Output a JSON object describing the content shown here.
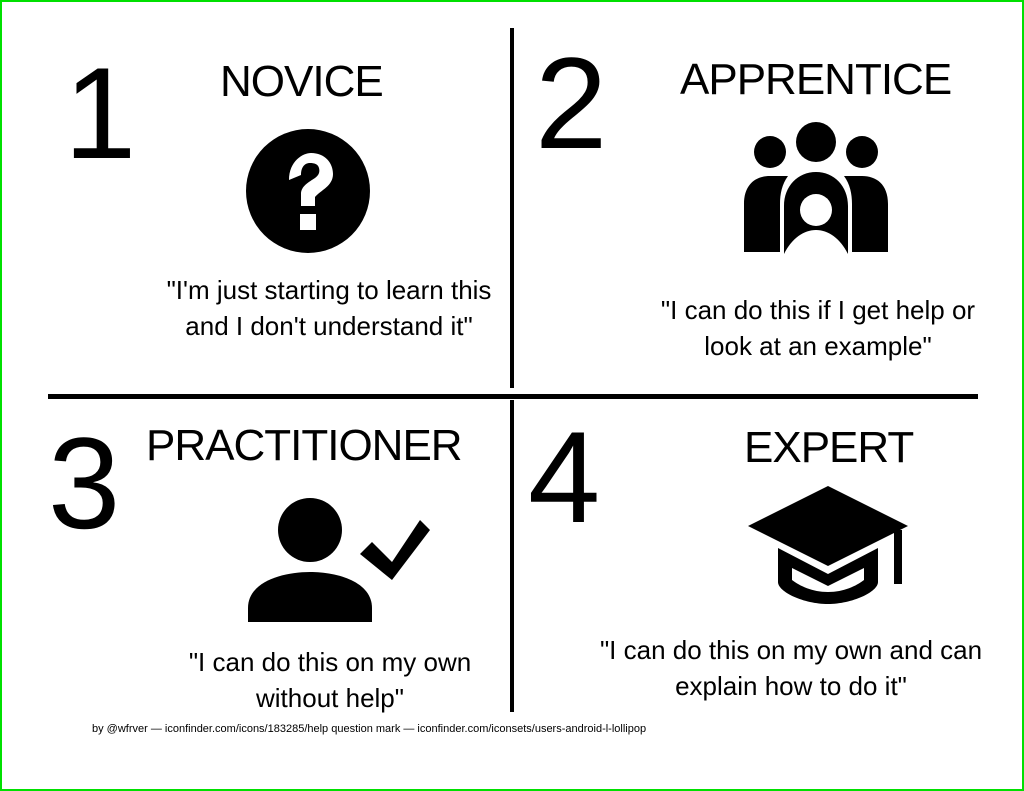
{
  "quadrants": [
    {
      "number": "1",
      "title": "NOVICE",
      "icon": "help-question-icon",
      "quote": "\"I'm just starting to learn this and I don't understand it\""
    },
    {
      "number": "2",
      "title": "APPRENTICE",
      "icon": "users-group-icon",
      "quote": "\"I can do this if I get help or look at an example\""
    },
    {
      "number": "3",
      "title": "PRACTITIONER",
      "icon": "user-check-icon",
      "quote": "\"I can do this on my own without help\""
    },
    {
      "number": "4",
      "title": "EXPERT",
      "icon": "graduation-cap-icon",
      "quote": "\"I can do this on my own and can explain how to do it\""
    }
  ],
  "credits": "by @wfrver — iconfinder.com/icons/183285/help question mark — iconfinder.com/iconsets/users-android-l-lollipop"
}
